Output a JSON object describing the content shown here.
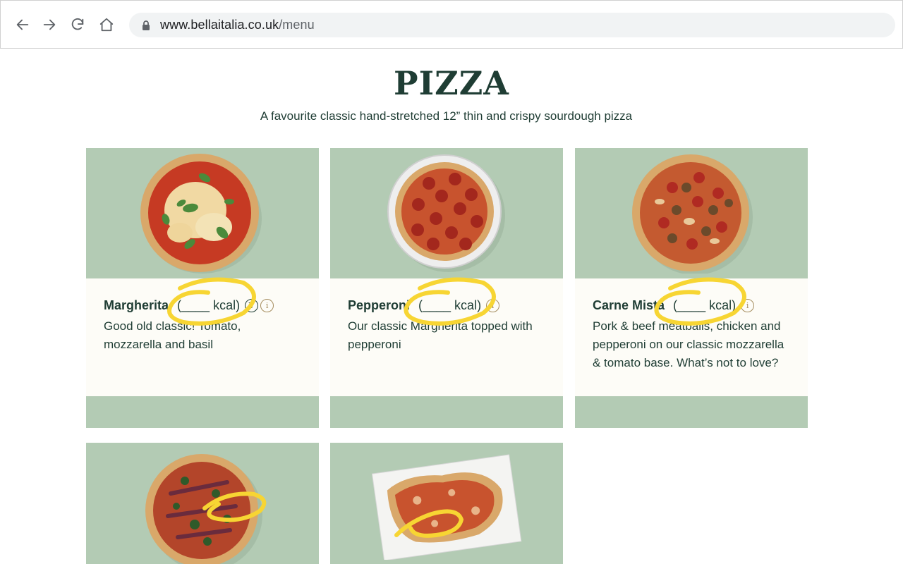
{
  "browser": {
    "url_domain": "www.bellaitalia.co.uk",
    "url_path": "/menu"
  },
  "section": {
    "title": "PIZZA",
    "subtitle": "A favourite classic hand-stretched 12” thin and crispy sourdough pizza"
  },
  "colors": {
    "brand_green": "#1f3d34",
    "card_bg": "#b3cbb4",
    "card_body": "#fdfcf7",
    "highlight": "#f7d533"
  },
  "cards": [
    {
      "name": "Margherita",
      "kcal": "(____ kcal)",
      "badges": [
        "V",
        "i"
      ],
      "description": "Good old classic! Tomato, mozzarella and basil"
    },
    {
      "name": "Pepperoni",
      "kcal": "(____ kcal)",
      "badges": [
        "i"
      ],
      "description": "Our classic Margherita topped with pepperoni"
    },
    {
      "name": "Carne Mista",
      "kcal": "(____ kcal)",
      "badges": [
        "i"
      ],
      "description": "Pork & beef meatballs, chicken and pepperoni on our classic mozzarella & tomato base. What’s not to love?"
    }
  ]
}
